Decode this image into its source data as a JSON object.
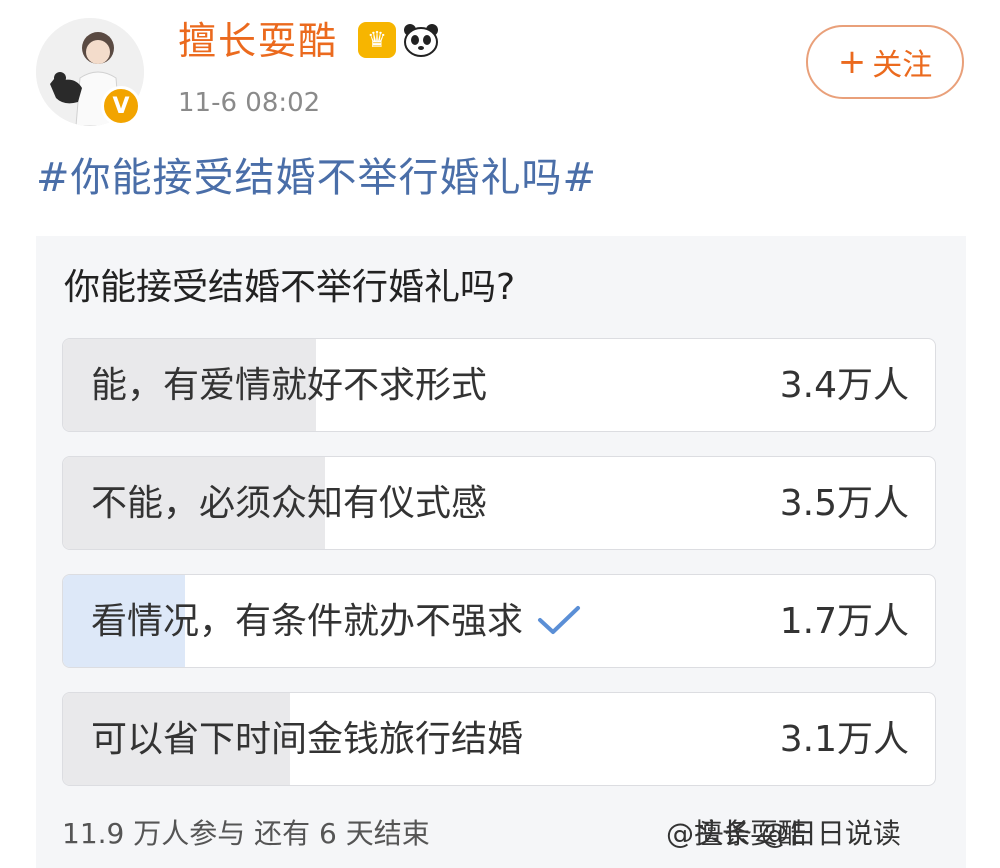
{
  "user": {
    "name": "擅长耍酷",
    "timestamp": "11-6 08:02",
    "verified_icon": "verified-v-icon",
    "badges": [
      "crown-badge-icon",
      "panda-badge-icon"
    ]
  },
  "follow_button": {
    "icon": "plus-icon",
    "label": "关注"
  },
  "topic": "#你能接受结婚不举行婚礼吗#",
  "poll": {
    "question": "你能接受结婚不举行婚礼吗?",
    "options": [
      {
        "label": "能，有爱情就好不求形式",
        "count": "3.4万人",
        "share": 0.29,
        "selected": false
      },
      {
        "label": "不能，必须众知有仪式感",
        "count": "3.5万人",
        "share": 0.3,
        "selected": false
      },
      {
        "label": "看情况，有条件就办不强求",
        "count": "1.7万人",
        "share": 0.14,
        "selected": true
      },
      {
        "label": "可以省下时间金钱旅行结婚",
        "count": "3.1万人",
        "share": 0.26,
        "selected": false
      }
    ],
    "stats": "11.9 万人参与  还有 6 天结束"
  },
  "watermark": {
    "prefix": "@擅长耍酷",
    "overlay": "头条 @日日说读"
  },
  "colors": {
    "accent": "#eb6a1e",
    "topic": "#4a6ea8",
    "selected_fill": "#dde8f8",
    "check": "#5b8fd6"
  }
}
